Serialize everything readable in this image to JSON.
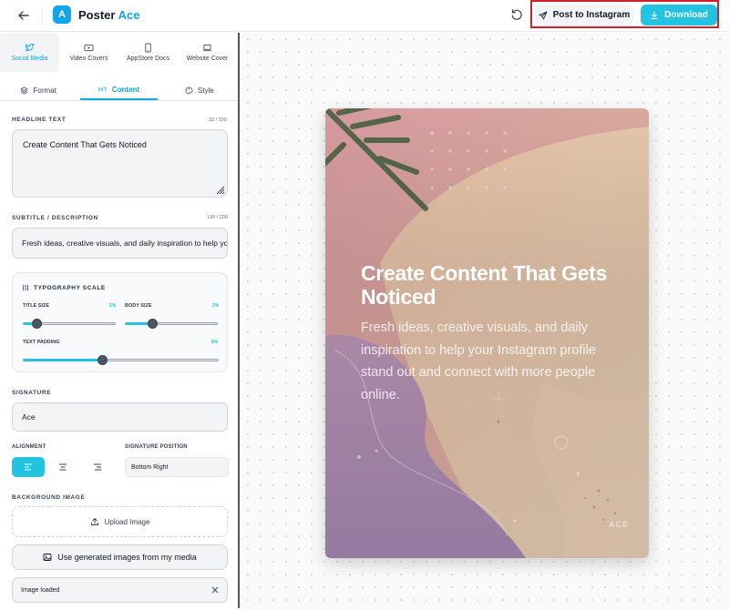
{
  "app": {
    "logo_letter": "A",
    "name_part1": "Poster",
    "name_part2": "Ace"
  },
  "header": {
    "post_label": "Post to Instagram",
    "download_label": "Download"
  },
  "categories": [
    {
      "label": "Social Media",
      "icon": "twitter-icon",
      "active": true
    },
    {
      "label": "Video Covers",
      "icon": "play-icon"
    },
    {
      "label": "AppStore Docs",
      "icon": "phone-icon"
    },
    {
      "label": "Website Cover",
      "icon": "laptop-icon"
    }
  ],
  "subtabs": [
    {
      "label": "Format",
      "icon": "layers-icon"
    },
    {
      "label": "Content",
      "icon": "heading-icon",
      "active": true
    },
    {
      "label": "Style",
      "icon": "palette-icon"
    }
  ],
  "headline": {
    "label": "HEADLINE TEXT",
    "count": "32 / 150",
    "value": "Create Content That Gets Noticed"
  },
  "subtitle": {
    "label": "SUBTITLE / DESCRIPTION",
    "count": "130 / 200",
    "value": "Fresh ideas, creative visuals, and daily inspiration to help your Instagram profile stand out and connect with more people online."
  },
  "typography": {
    "title": "TYPOGRAPHY SCALE",
    "title_size_label": "TITLE SIZE",
    "title_size_value": "5%",
    "title_size_level": 0.15,
    "body_size_label": "BODY SIZE",
    "body_size_value": "3%",
    "body_size_level": 0.3,
    "padding_label": "TEXT PADDING",
    "padding_value": "8%",
    "padding_level": 0.41
  },
  "signature": {
    "label": "SIGNATURE",
    "value": "Ace"
  },
  "alignment": {
    "label": "ALIGNMENT",
    "selected": "left"
  },
  "signature_position": {
    "label": "SIGNATURE POSITION",
    "value": "Bottom Right"
  },
  "background_image": {
    "label": "BACKGROUND IMAGE",
    "upload_label": "Upload Image",
    "generated_label": "Use generated images from my media",
    "status": "Image loaded"
  },
  "poster": {
    "title": "Create Content That Gets Noticed",
    "subtitle": "Fresh ideas, creative visuals, and daily inspiration to help your Instagram profile stand out and connect with more people online.",
    "signature": "ACE"
  },
  "colors": {
    "accent": "#22c2e0",
    "brand": "#0ea5e9",
    "highlight": "#d0212a"
  }
}
